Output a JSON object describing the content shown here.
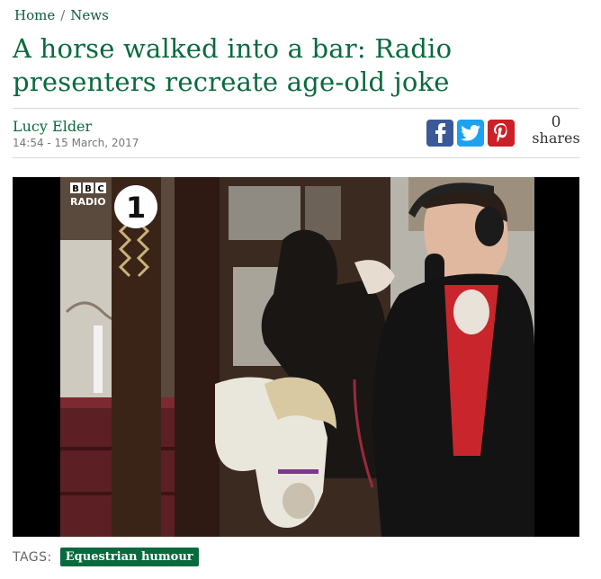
{
  "breadcrumb": {
    "home": "Home",
    "separator": "/",
    "section": "News"
  },
  "article": {
    "headline": "A horse walked into a bar: Radio presenters recreate age-old joke",
    "author": "Lucy Elder",
    "date": "14:54 - 15 March, 2017"
  },
  "share": {
    "facebook_icon": "facebook-icon",
    "twitter_icon": "twitter-icon",
    "pinterest_icon": "pinterest-icon",
    "count": "0",
    "label": "shares",
    "colors": {
      "facebook": "#3b5998",
      "twitter": "#1da1f2",
      "pinterest": "#cb2027"
    }
  },
  "video": {
    "logo_line1": "BBC",
    "logo_line2": "RADIO",
    "station_number": "1"
  },
  "tags": {
    "label": "TAGS:",
    "items": [
      "Equestrian humour"
    ]
  },
  "colors": {
    "brand_green": "#0a6a3e"
  }
}
